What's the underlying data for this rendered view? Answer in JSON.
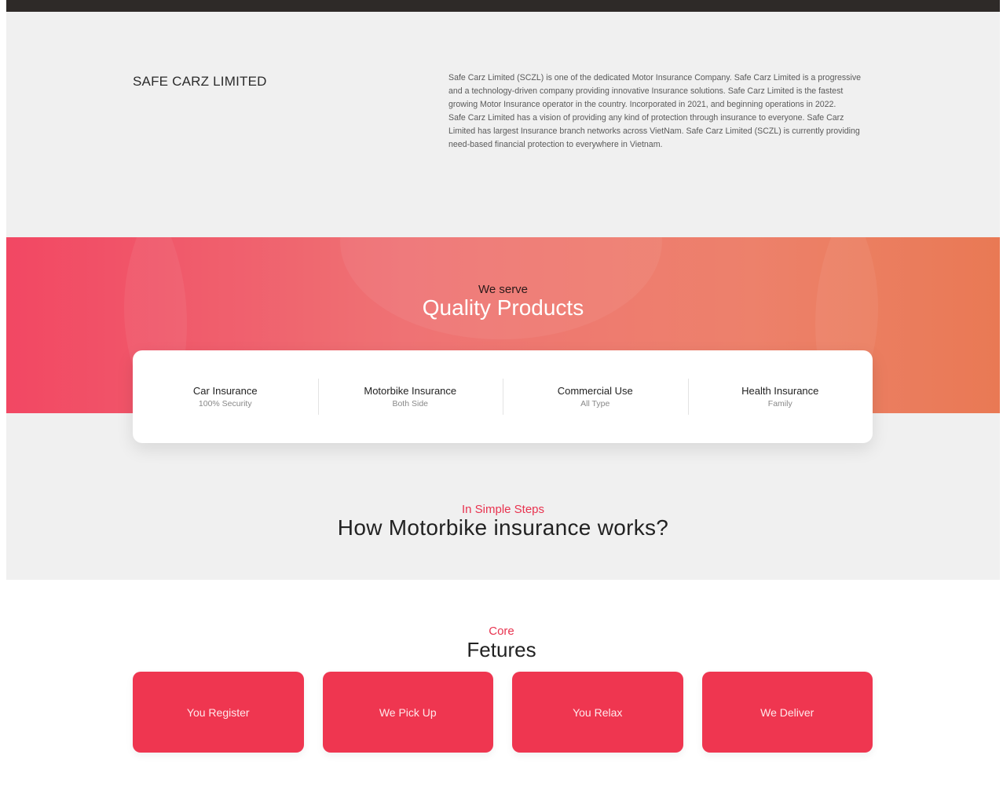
{
  "about": {
    "company_name": "SAFE CARZ LIMITED",
    "paragraph_1": "Safe Carz Limited (SCZL) is one of the dedicated Motor Insurance Company. Safe Carz Limited is a progressive and a technology-driven company providing innovative Insurance solutions. Safe Carz Limited is the fastest growing Motor Insurance operator in the country. Incorporated in 2021, and beginning operations in 2022.",
    "paragraph_2": "Safe Carz Limited has a vision of providing any kind of protection through insurance to everyone. Safe Carz Limited has largest Insurance branch networks across VietNam. Safe Carz Limited (SCZL) is currently providing need-based financial protection to everywhere in Vietnam."
  },
  "hero": {
    "kicker": "We serve",
    "title": "Quality Products"
  },
  "products": [
    {
      "name": "Car Insurance",
      "desc": "100% Security"
    },
    {
      "name": "Motorbike Insurance",
      "desc": "Both Side"
    },
    {
      "name": "Commercial Use",
      "desc": "All Type"
    },
    {
      "name": "Health Insurance",
      "desc": "Family"
    }
  ],
  "steps": {
    "kicker": "In Simple Steps",
    "title": "How Motorbike insurance works?"
  },
  "core": {
    "kicker": "Core",
    "title": "Fetures",
    "features": [
      "You Register",
      "We Pick Up",
      "You Relax",
      "We Deliver"
    ]
  },
  "colors": {
    "accent": "#e8334f",
    "feature_bg": "#ef3650",
    "section_bg": "#f0f0f0",
    "topbar": "#2e2a28"
  }
}
